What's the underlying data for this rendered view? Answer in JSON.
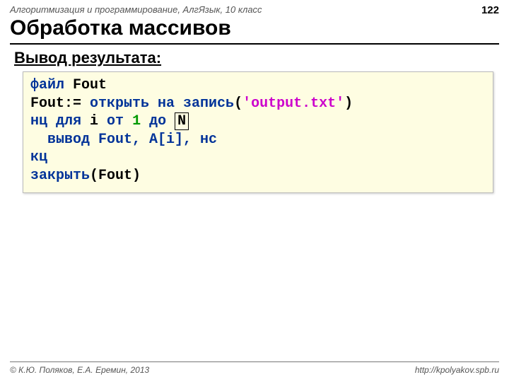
{
  "header": {
    "course": "Алгоритмизация и программирование, АлгЯзык, 10 класс",
    "page_number": "122"
  },
  "title": "Обработка массивов",
  "subtitle": "Вывод результата:",
  "code": {
    "kw_file": "файл",
    "var_fout": "Fout",
    "assign_lhs": "Fout:= ",
    "kw_open": "открыть на запись",
    "paren_open": "(",
    "string": "'output.txt'",
    "paren_close": ")",
    "kw_nc": "нц",
    "kw_for": " для ",
    "var_i": "i",
    "kw_from": " от ",
    "num_1": "1",
    "kw_to": " до ",
    "var_n": "N",
    "kw_output_line": "  вывод Fout, A[i], нс",
    "kw_kc": "кц",
    "kw_close": "закрыть",
    "close_arg": "(Fout)"
  },
  "footer": {
    "copyright": "© К.Ю. Поляков, Е.А. Еремин, 2013",
    "url": "http://kpolyakov.spb.ru"
  }
}
